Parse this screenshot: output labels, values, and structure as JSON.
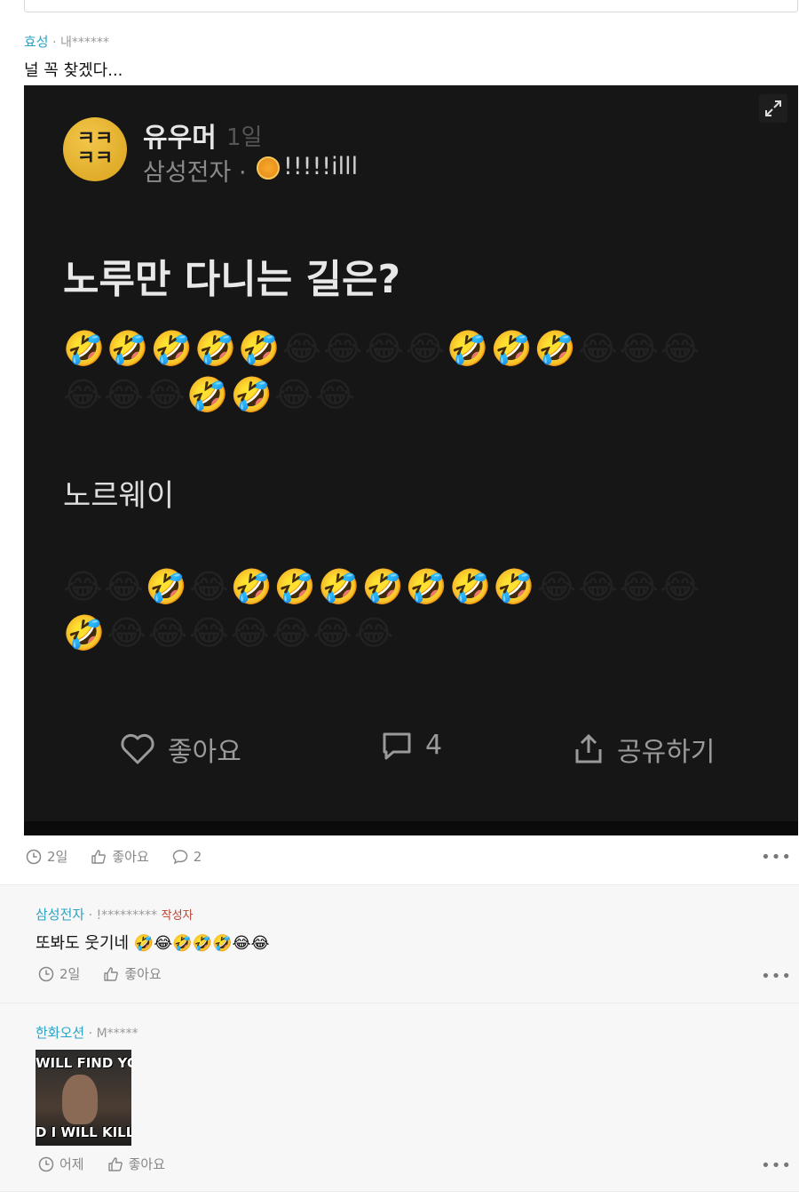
{
  "comment_main": {
    "company": "효성",
    "user": "내******",
    "text": "널 꼭 찾겠다...",
    "footer": {
      "time": "2일",
      "like": "좋아요",
      "reply_count": "2"
    }
  },
  "embedded_post": {
    "avatar_text_line1": "ㅋㅋ",
    "avatar_text_line2": "ㅋㅋ",
    "author": "유우머",
    "time": "1일",
    "company": "삼성전자 ·",
    "user_id": "!!!!!illl",
    "title": "노루만 다니는 길은?",
    "emoji_row1": "🤣🤣🤣🤣🤣😂😂😂😂🤣🤣🤣😂😂😂",
    "emoji_row2": "😂😂😂🤣🤣😂😂",
    "answer": "노르웨이",
    "emoji_row3": "😂😂🤣😂🤣🤣🤣🤣🤣🤣🤣😂😂😂😂",
    "emoji_row4": "🤣😂😂😂😂😂😂😂",
    "actions": {
      "like": "좋아요",
      "comments": "4",
      "share": "공유하기"
    }
  },
  "reply1": {
    "company": "삼성전자",
    "user": "!*********",
    "badge": "작성자",
    "text": "또봐도 웃기네 🤣😂🤣🤣🤣😂😂",
    "footer": {
      "time": "2일",
      "like": "좋아요"
    }
  },
  "reply2": {
    "company": "한화오션",
    "user": "M*****",
    "image_top": "WILL FIND YO",
    "image_bottom": "D I WILL KILL Y",
    "footer": {
      "time": "어제",
      "like": "좋아요"
    }
  },
  "icons": {
    "more": "more-icon",
    "clock": "clock-icon",
    "thumbs_up": "thumbs-up-icon",
    "comment": "comment-icon",
    "heart": "heart-icon",
    "share": "share-icon",
    "expand": "expand-icon"
  },
  "colors": {
    "company_link": "#2ba3c4",
    "author_badge": "#b8432f",
    "post_bg": "#161616"
  }
}
